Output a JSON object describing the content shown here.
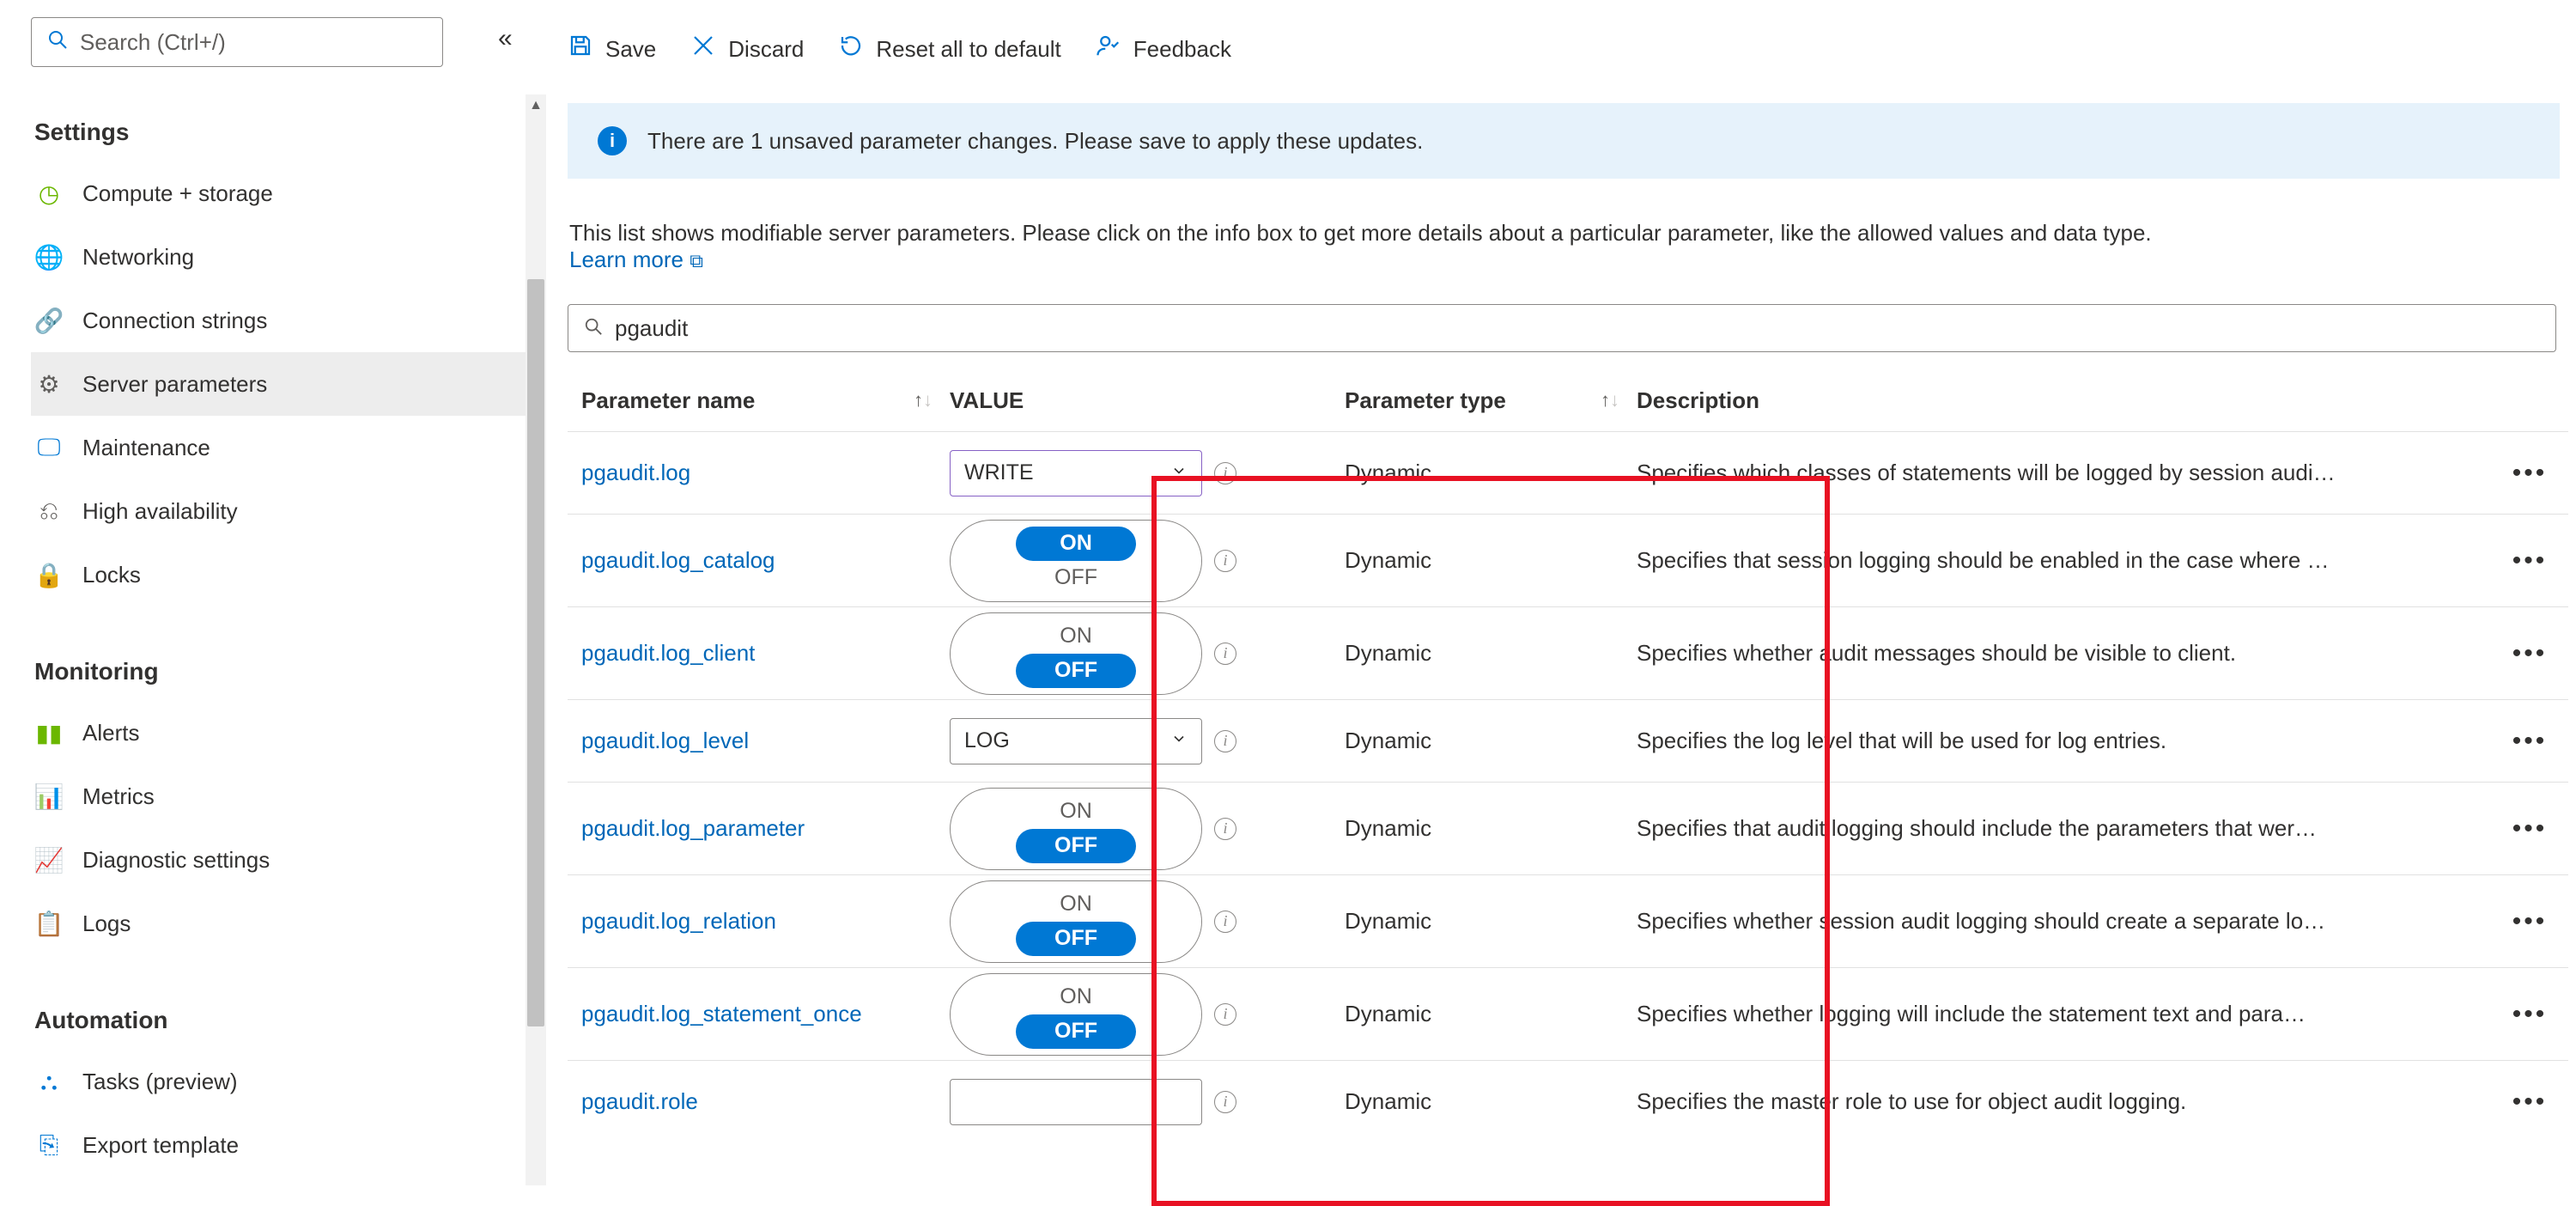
{
  "sidebar": {
    "search_placeholder": "Search (Ctrl+/)",
    "sections": [
      {
        "title": "Settings",
        "items": [
          {
            "icon": "#6bb700",
            "glyph": "◷",
            "label": "Compute + storage"
          },
          {
            "icon": "#0078d4",
            "glyph": "🌐",
            "label": "Networking"
          },
          {
            "icon": "#605e5c",
            "glyph": "🔗",
            "label": "Connection strings"
          },
          {
            "icon": "#605e5c",
            "glyph": "⚙",
            "label": "Server parameters",
            "selected": true
          },
          {
            "icon": "#0078d4",
            "glyph": "🖵",
            "label": "Maintenance"
          },
          {
            "icon": "#605e5c",
            "glyph": "⎌",
            "label": "High availability"
          },
          {
            "icon": "#0078d4",
            "glyph": "🔒",
            "label": "Locks"
          }
        ]
      },
      {
        "title": "Monitoring",
        "items": [
          {
            "icon": "#6bb700",
            "glyph": "▮▮",
            "label": "Alerts"
          },
          {
            "icon": "#e3008c",
            "glyph": "📊",
            "label": "Metrics"
          },
          {
            "icon": "#6bb700",
            "glyph": "📈",
            "label": "Diagnostic settings"
          },
          {
            "icon": "#0078d4",
            "glyph": "📋",
            "label": "Logs"
          }
        ]
      },
      {
        "title": "Automation",
        "items": [
          {
            "icon": "#0078d4",
            "glyph": "⛬",
            "label": "Tasks (preview)"
          },
          {
            "icon": "#0078d4",
            "glyph": "⎘",
            "label": "Export template"
          }
        ]
      }
    ]
  },
  "toolbar": {
    "save": "Save",
    "discard": "Discard",
    "reset": "Reset all to default",
    "feedback": "Feedback"
  },
  "banner": "There are 1 unsaved parameter changes.  Please save to apply these updates.",
  "hint": "This list shows modifiable server parameters. Please click on the info box to get more details about a particular parameter, like the allowed values and data type.",
  "learn_more": "Learn more",
  "filter_value": "pgaudit",
  "columns": {
    "name": "Parameter name",
    "value": "VALUE",
    "type": "Parameter type",
    "desc": "Description"
  },
  "on_label": "ON",
  "off_label": "OFF",
  "params": [
    {
      "name": "pgaudit.log",
      "kind": "dropdown",
      "value": "WRITE",
      "modified": true,
      "type": "Dynamic",
      "desc": "Specifies which classes of statements will be logged by session audi…"
    },
    {
      "name": "pgaudit.log_catalog",
      "kind": "toggle",
      "value": "ON",
      "type": "Dynamic",
      "desc": "Specifies that session logging should be enabled in the case where …"
    },
    {
      "name": "pgaudit.log_client",
      "kind": "toggle",
      "value": "OFF",
      "type": "Dynamic",
      "desc": "Specifies whether audit messages should be visible to client."
    },
    {
      "name": "pgaudit.log_level",
      "kind": "dropdown",
      "value": "LOG",
      "type": "Dynamic",
      "desc": "Specifies the log level that will be used for log entries."
    },
    {
      "name": "pgaudit.log_parameter",
      "kind": "toggle",
      "value": "OFF",
      "type": "Dynamic",
      "desc": "Specifies that audit logging should include the parameters that wer…"
    },
    {
      "name": "pgaudit.log_relation",
      "kind": "toggle",
      "value": "OFF",
      "type": "Dynamic",
      "desc": "Specifies whether session audit logging should create a separate lo…"
    },
    {
      "name": "pgaudit.log_statement_once",
      "kind": "toggle",
      "value": "OFF",
      "type": "Dynamic",
      "desc": "Specifies whether logging will include the statement text and para…"
    },
    {
      "name": "pgaudit.role",
      "kind": "text",
      "value": "",
      "type": "Dynamic",
      "desc": "Specifies the master role to use for object audit logging."
    }
  ]
}
